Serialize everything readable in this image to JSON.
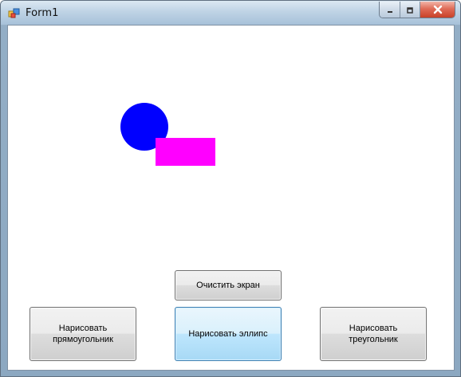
{
  "window": {
    "title": "Form1",
    "icon": "form-app-icon"
  },
  "caption_buttons": {
    "minimize": "minimize-icon",
    "maximize": "maximize-icon",
    "close": "close-icon"
  },
  "canvas": {
    "shapes": [
      {
        "type": "ellipse",
        "fill": "#0000ff"
      },
      {
        "type": "rectangle",
        "fill": "#ff00ff"
      }
    ]
  },
  "buttons": {
    "clear": "Очистить экран",
    "draw_rectangle": "Нарисовать прямоугольник",
    "draw_ellipse": "Нарисовать эллипс",
    "draw_triangle": "Нарисовать треугольник"
  },
  "colors": {
    "circle": "#0000ff",
    "rectangle": "#ff00ff",
    "selected_button": "#bee6fd"
  }
}
